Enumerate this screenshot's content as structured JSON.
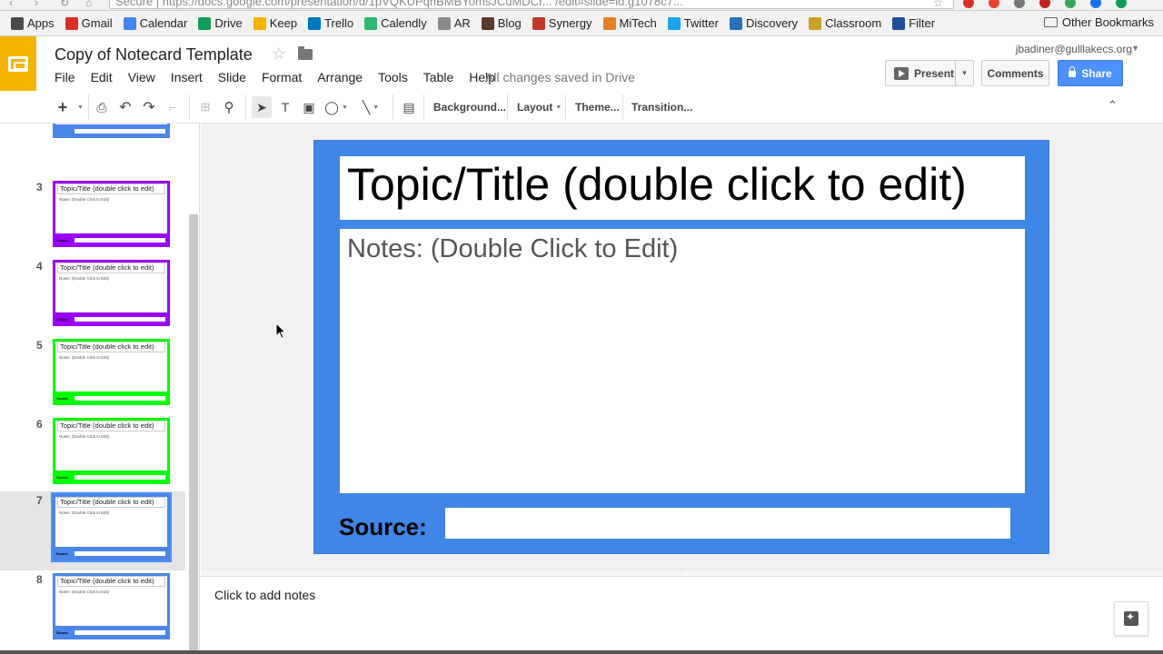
{
  "browser": {
    "url": "Secure | https://docs.google.com/presentation/d/1pVQKUPqnBMBYomsJCuMDCr... /edit#slide=id.g1078c7..."
  },
  "bookmarks": [
    {
      "label": "Apps",
      "icon": "apps-grid-icon",
      "color": "#4a4a4a"
    },
    {
      "label": "Gmail",
      "icon": "gmail-icon",
      "color": "#d93025"
    },
    {
      "label": "Calendar",
      "icon": "calendar-icon",
      "color": "#4285f4"
    },
    {
      "label": "Drive",
      "icon": "drive-icon",
      "color": "#0f9d58"
    },
    {
      "label": "Keep",
      "icon": "keep-icon",
      "color": "#f4b400"
    },
    {
      "label": "Trello",
      "icon": "trello-icon",
      "color": "#0079bf"
    },
    {
      "label": "Calendly",
      "icon": "calendly-icon",
      "color": "#2eb872"
    },
    {
      "label": "AR",
      "icon": "ar-icon",
      "color": "#8a8a8a"
    },
    {
      "label": "Blog",
      "icon": "blog-icon",
      "color": "#5b3a29"
    },
    {
      "label": "Synergy",
      "icon": "synergy-icon",
      "color": "#c0392b"
    },
    {
      "label": "MiTech",
      "icon": "mitech-icon",
      "color": "#e67e22"
    },
    {
      "label": "Twitter",
      "icon": "twitter-icon",
      "color": "#1da1f2"
    },
    {
      "label": "Discovery",
      "icon": "discovery-icon",
      "color": "#2c6fbb"
    },
    {
      "label": "Classroom",
      "icon": "classroom-icon",
      "color": "#c9a227"
    },
    {
      "label": "Filter",
      "icon": "filter-icon",
      "color": "#1f4e9c"
    }
  ],
  "other_bookmarks": "Other Bookmarks",
  "header": {
    "doc_title": "Copy of Notecard Template",
    "menus": [
      "File",
      "Edit",
      "View",
      "Insert",
      "Slide",
      "Format",
      "Arrange",
      "Tools",
      "Table",
      "Help"
    ],
    "save_status": "All changes saved in Drive",
    "account": "jbadiner@gulllakecs.org",
    "present_label": "Present",
    "comments_label": "Comments",
    "share_label": "Share"
  },
  "toolbar": {
    "background_label": "Background...",
    "layout_label": "Layout",
    "theme_label": "Theme...",
    "transition_label": "Transition..."
  },
  "filmstrip": [
    {
      "num": "",
      "border": "#4a86e8",
      "title": "",
      "notes": "",
      "partial": true
    },
    {
      "num": "3",
      "border": "#9900ff",
      "title": "Topic/Title (double click to edit)",
      "notes": "Notes: (Double Click to Edit)",
      "source": "Source:"
    },
    {
      "num": "4",
      "border": "#9900ff",
      "title": "Topic/Title (double click to edit)",
      "notes": "Notes: (Double Click to Edit)",
      "source": "Source:"
    },
    {
      "num": "5",
      "border": "#00ff00",
      "title": "Topic/Title (double click to edit)",
      "notes": "Notes: (Double Click to Edit)",
      "source": "Source:"
    },
    {
      "num": "6",
      "border": "#00ff00",
      "title": "Topic/Title (double click to edit)",
      "notes": "Notes: (Double Click to Edit)",
      "source": "Source:"
    },
    {
      "num": "7",
      "border": "#4a86e8",
      "title": "Topic/Title (double click to edit)",
      "notes": "Notes: (Double Click to Edit)",
      "source": "Source:",
      "selected": true
    },
    {
      "num": "8",
      "border": "#4a86e8",
      "title": "Topic/Title (double click to edit)",
      "notes": "Notes: (Double Click to Edit)",
      "source": "Source:"
    }
  ],
  "slide": {
    "title": "Topic/Title (double click to edit)",
    "notes": "Notes: (Double Click to Edit)",
    "source_label": "Source:",
    "background": "#3f86e6"
  },
  "speaker_notes_placeholder": "Click to add notes"
}
